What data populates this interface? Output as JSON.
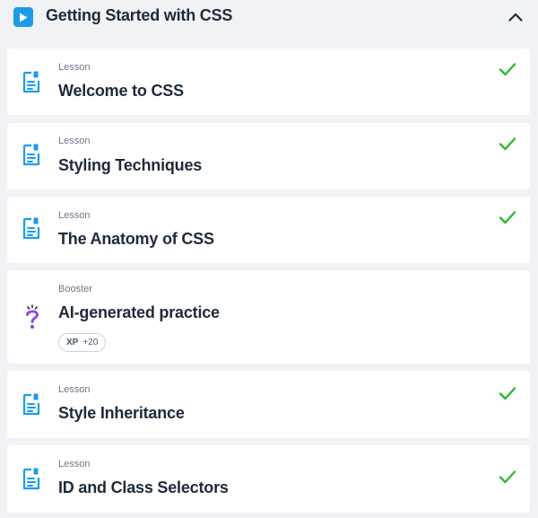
{
  "module": {
    "title": "Getting Started with CSS",
    "icon": "play-icon",
    "toggle_icon": "chevron-up-icon",
    "accent_color": "#1c9ce8"
  },
  "items": [
    {
      "type": "Lesson",
      "title": "Welcome to CSS",
      "icon": "document-icon",
      "completed": true
    },
    {
      "type": "Lesson",
      "title": "Styling Techniques",
      "icon": "document-icon",
      "completed": true
    },
    {
      "type": "Lesson",
      "title": "The Anatomy of CSS",
      "icon": "document-icon",
      "completed": true
    },
    {
      "type": "Booster",
      "title": "AI-generated practice",
      "icon": "question-mark-icon",
      "completed": false,
      "badge": {
        "label": "XP",
        "value": "+20"
      }
    },
    {
      "type": "Lesson",
      "title": "Style Inheritance",
      "icon": "document-icon",
      "completed": true
    },
    {
      "type": "Lesson",
      "title": "ID and Class Selectors",
      "icon": "document-icon",
      "completed": true
    }
  ],
  "colors": {
    "check": "#2eb82e",
    "booster_icon": "#8a4fd8",
    "lesson_icon": "#1c9ce8"
  }
}
